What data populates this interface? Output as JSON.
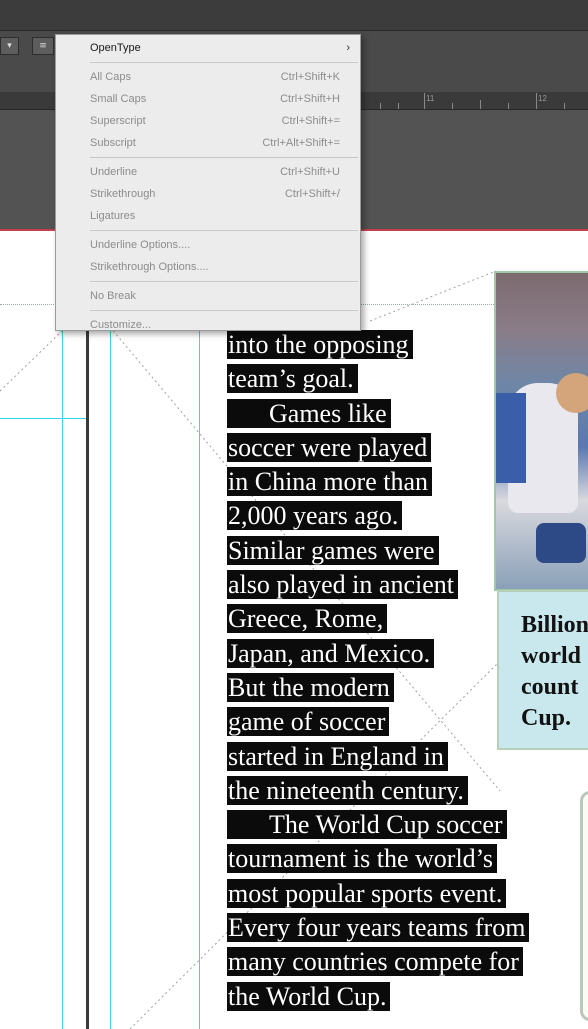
{
  "ruler": {
    "marks": [
      "11",
      "12"
    ]
  },
  "menu": {
    "groups": [
      [
        {
          "label": "OpenType",
          "shortcut": "",
          "submenu": true,
          "enabled": true
        }
      ],
      [
        {
          "label": "All Caps",
          "shortcut": "Ctrl+Shift+K",
          "enabled": false
        },
        {
          "label": "Small Caps",
          "shortcut": "Ctrl+Shift+H",
          "enabled": false
        },
        {
          "label": "Superscript",
          "shortcut": "Ctrl+Shift+=",
          "enabled": false
        },
        {
          "label": "Subscript",
          "shortcut": "Ctrl+Alt+Shift+=",
          "enabled": false
        }
      ],
      [
        {
          "label": "Underline",
          "shortcut": "Ctrl+Shift+U",
          "enabled": false
        },
        {
          "label": "Strikethrough",
          "shortcut": "Ctrl+Shift+/",
          "enabled": false
        },
        {
          "label": "Ligatures",
          "shortcut": "",
          "enabled": false
        }
      ],
      [
        {
          "label": "Underline Options....",
          "shortcut": "",
          "enabled": false
        },
        {
          "label": "Strikethrough Options....",
          "shortcut": "",
          "enabled": false
        }
      ],
      [
        {
          "label": "No Break",
          "shortcut": "",
          "enabled": false
        }
      ],
      [
        {
          "label": "Customize...",
          "shortcut": "",
          "enabled": false
        }
      ]
    ]
  },
  "story": {
    "lines": [
      {
        "text": "into the opposing",
        "indent": false
      },
      {
        "text": "team’s goal.",
        "indent": false
      },
      {
        "text": "Games like",
        "indent": true
      },
      {
        "text": "soccer were played",
        "indent": false
      },
      {
        "text": "in China more than",
        "indent": false
      },
      {
        "text": "2,000 years ago.",
        "indent": false
      },
      {
        "text": "Similar games were",
        "indent": false
      },
      {
        "text": "also played in ancient",
        "indent": false
      },
      {
        "text": "Greece, Rome,",
        "indent": false
      },
      {
        "text": "Japan, and Mexico.",
        "indent": false
      },
      {
        "text": "But the modern",
        "indent": false
      },
      {
        "text": "game of soccer",
        "indent": false
      },
      {
        "text": "started in England in",
        "indent": false
      },
      {
        "text": "the nineteenth century.",
        "indent": false
      },
      {
        "text": "The World Cup soccer",
        "indent": true
      },
      {
        "text": "tournament is the world’s",
        "indent": false
      },
      {
        "text": "most popular sports event.",
        "indent": false
      },
      {
        "text": "Every four years teams from",
        "indent": false
      },
      {
        "text": "many countries compete for",
        "indent": false
      },
      {
        "text": "the World Cup.",
        "indent": false
      }
    ]
  },
  "caption": {
    "lines": [
      "Billion",
      "world",
      "count",
      "Cup."
    ]
  },
  "colors": {
    "selection": "#0b0b0b",
    "guide": "#3ed3e8",
    "caption_bg": "#c8e8ee",
    "chrome": "#4a4a4a"
  }
}
